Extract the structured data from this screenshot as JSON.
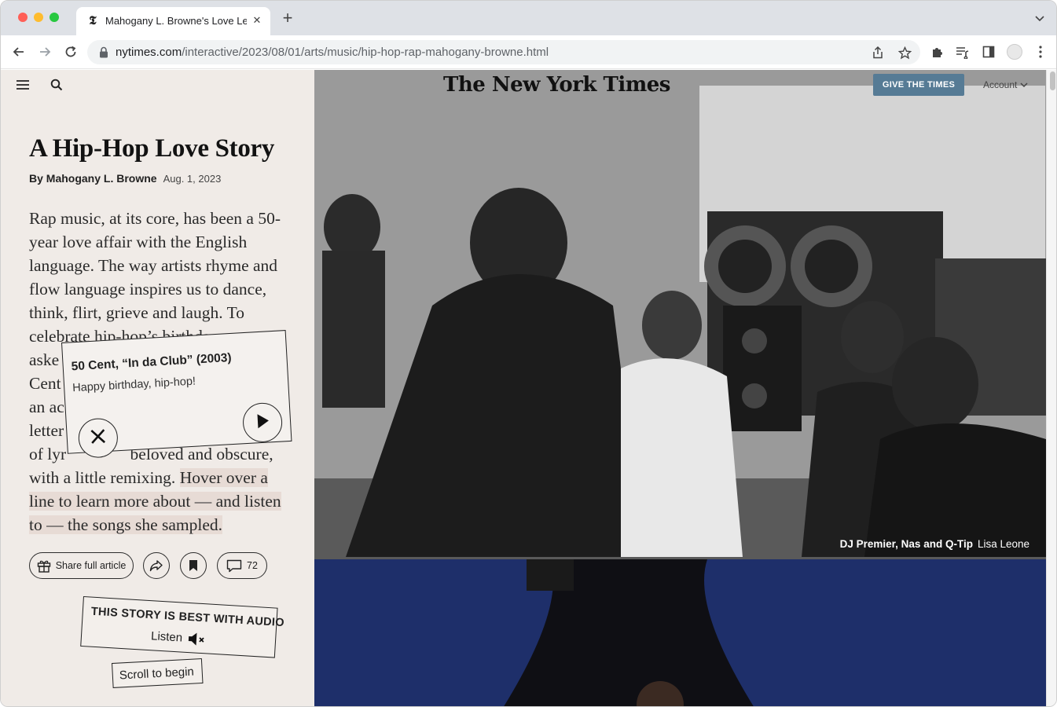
{
  "browser": {
    "tab_title": "Mahogany L. Browne's Love Letter to Hip-Hop",
    "tab_favicon": "𝕿",
    "url_host": "nytimes.com",
    "url_path": "/interactive/2023/08/01/arts/music/hip-hop-rap-mahogany-browne.html",
    "icons": [
      "back-icon",
      "forward-icon",
      "reload-icon",
      "lock-icon",
      "share-icon",
      "star-icon",
      "extensions-icon",
      "reading-list-icon",
      "side-panel-icon",
      "profile-icon",
      "more-icon"
    ]
  },
  "header": {
    "logo": "The New York Times",
    "give_button": "GIVE THE TIMES",
    "account": "Account"
  },
  "article": {
    "headline": "A Hip-Hop Love Story",
    "author": "By Mahogany L. Browne",
    "date": "Aug. 1, 2023",
    "body_p1": "Rap music, at its core, has been a 50-year love affair with the English language. The way artists rhyme and flow language inspires us to dance, think, flirt, grieve and laugh. To celebrate hip-hop’s birthday, we",
    "body_l1": "aske",
    "body_l2": "Cent",
    "body_l3": "an ac",
    "body_l4": "letter",
    "body_l5a": "of lyr",
    "body_l5b": "beloved and obscure,",
    "body_p2": "with a little remixing.",
    "body_hl": "Hover over a line to learn more about — and listen to — the songs she sampled."
  },
  "share": {
    "share_label": "Share full article",
    "comments": "72"
  },
  "card": {
    "title": "50 Cent, “In da Club” (2003)",
    "subtitle": "Happy birthday, hip-hop!"
  },
  "audio": {
    "title": "THIS STORY IS BEST WITH AUDIO",
    "listen": "Listen",
    "scroll": "Scroll to begin"
  },
  "photo": {
    "caption": "DJ Premier, Nas and Q-Tip",
    "credit": "Lisa Leone"
  }
}
